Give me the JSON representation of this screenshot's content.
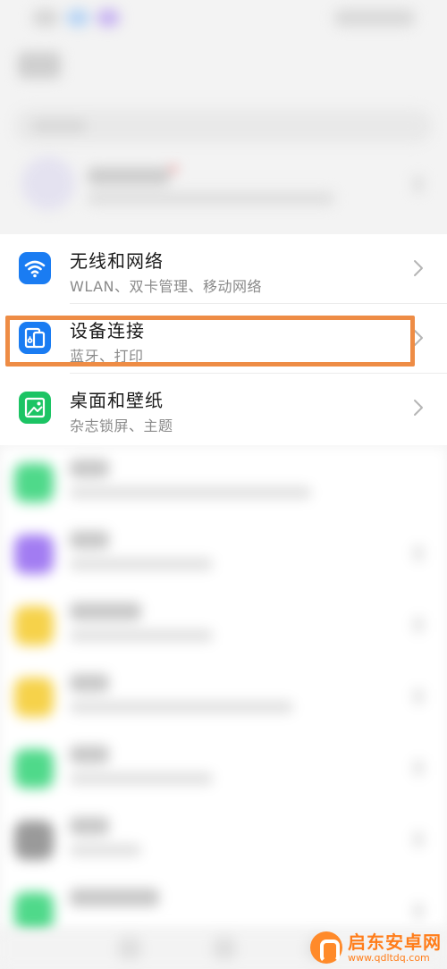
{
  "settings": {
    "items": [
      {
        "title": "无线和网络",
        "subtitle": "WLAN、双卡管理、移动网络",
        "icon": "wifi-icon",
        "icon_color": "#1a7cf2"
      },
      {
        "title": "设备连接",
        "subtitle": "蓝牙、打印",
        "icon": "device-connect-icon",
        "icon_color": "#1a7cf2",
        "highlighted": true
      },
      {
        "title": "桌面和壁纸",
        "subtitle": "杂志锁屏、主题",
        "icon": "wallpaper-icon",
        "icon_color": "#1cc464"
      }
    ]
  },
  "highlight_color": "#ee8c45",
  "watermark": {
    "name": "启东安卓网",
    "url": "www.qdltdq.com"
  }
}
